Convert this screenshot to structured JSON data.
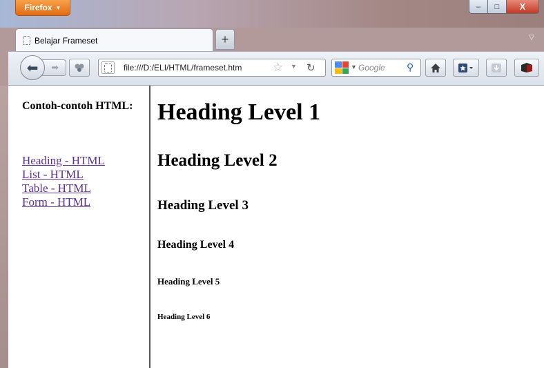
{
  "window": {
    "app_button": "Firefox",
    "controls": {
      "minimize": "–",
      "maximize": "□",
      "close": "X"
    }
  },
  "tabs": [
    {
      "title": "Belajar Frameset",
      "active": true
    }
  ],
  "toolbar": {
    "new_tab": "+",
    "url": "file:///D:/ELI/HTML/frameset.htm",
    "search_placeholder": "Google",
    "icons": [
      "back-icon",
      "forward-icon",
      "extension-icon",
      "site-identity-icon",
      "bookmark-star-icon",
      "reload-icon",
      "google-logo-icon",
      "search-icon",
      "home-icon",
      "bookmarks-menu-icon",
      "downloads-icon",
      "addon-icon"
    ]
  },
  "sidebar_frame": {
    "heading": "Contoh-contoh HTML:",
    "links": [
      "Heading - HTML",
      "List - HTML",
      "Table - HTML",
      "Form - HTML"
    ]
  },
  "main_frame": {
    "headings": [
      "Heading Level 1",
      "Heading Level 2",
      "Heading Level 3",
      "Heading Level 4",
      "Heading Level 5",
      "Heading Level 6"
    ]
  },
  "colors": {
    "link": "#5a2f96",
    "firefox_button": "#e97a20",
    "close_button": "#c33a24"
  }
}
